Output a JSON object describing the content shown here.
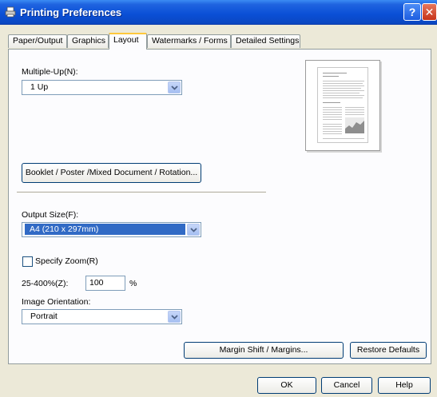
{
  "window": {
    "title": "Printing Preferences",
    "help_label": "?",
    "close_label": "✕"
  },
  "tabs": [
    {
      "label": "Paper/Output"
    },
    {
      "label": "Graphics"
    },
    {
      "label": "Layout"
    },
    {
      "label": "Watermarks / Forms"
    },
    {
      "label": "Detailed Settings"
    }
  ],
  "active_tab": "Layout",
  "layout": {
    "multiple_up_label": "Multiple-Up(N):",
    "multiple_up_value": "1 Up",
    "booklet_button": "Booklet / Poster /Mixed Document / Rotation...",
    "output_size_label": "Output Size(F):",
    "output_size_value": "A4 (210 x 297mm)",
    "specify_zoom_label": "Specify Zoom(R)",
    "specify_zoom_checked": false,
    "zoom_range_label": "25-400%(Z):",
    "zoom_value": "100",
    "zoom_unit": "%",
    "image_orientation_label": "Image Orientation:",
    "image_orientation_value": "Portrait",
    "margin_shift_button": "Margin Shift / Margins...",
    "restore_defaults_button": "Restore Defaults"
  },
  "footer": {
    "ok": "OK",
    "cancel": "Cancel",
    "help": "Help"
  },
  "colors": {
    "title_bar": "#0a4fd6",
    "selection": "#316ac5",
    "tab_highlight": "#ffc83c"
  },
  "icons": [
    "printer-icon",
    "help-icon",
    "close-icon",
    "chevron-down-icon"
  ]
}
